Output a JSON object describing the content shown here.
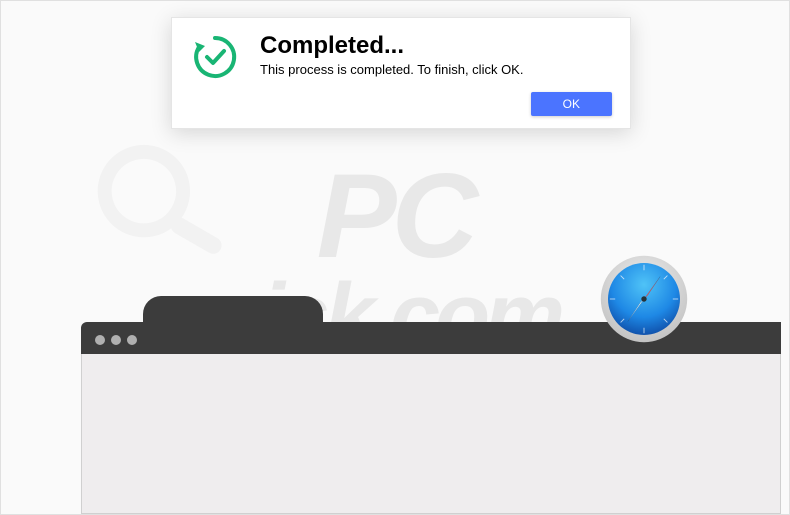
{
  "dialog": {
    "title": "Completed...",
    "message": "This process is completed. To finish, click OK.",
    "ok_label": "OK"
  },
  "colors": {
    "button_bg": "#4b74ff",
    "icon_ring": "#19b574",
    "browser_dark": "#3c3c3c",
    "browser_body": "#efedee"
  },
  "watermark": {
    "line1": "PC",
    "line2": "risk.com"
  },
  "icons": {
    "dialog_icon": "checkmark-refresh-icon",
    "app_icon": "safari-icon"
  }
}
